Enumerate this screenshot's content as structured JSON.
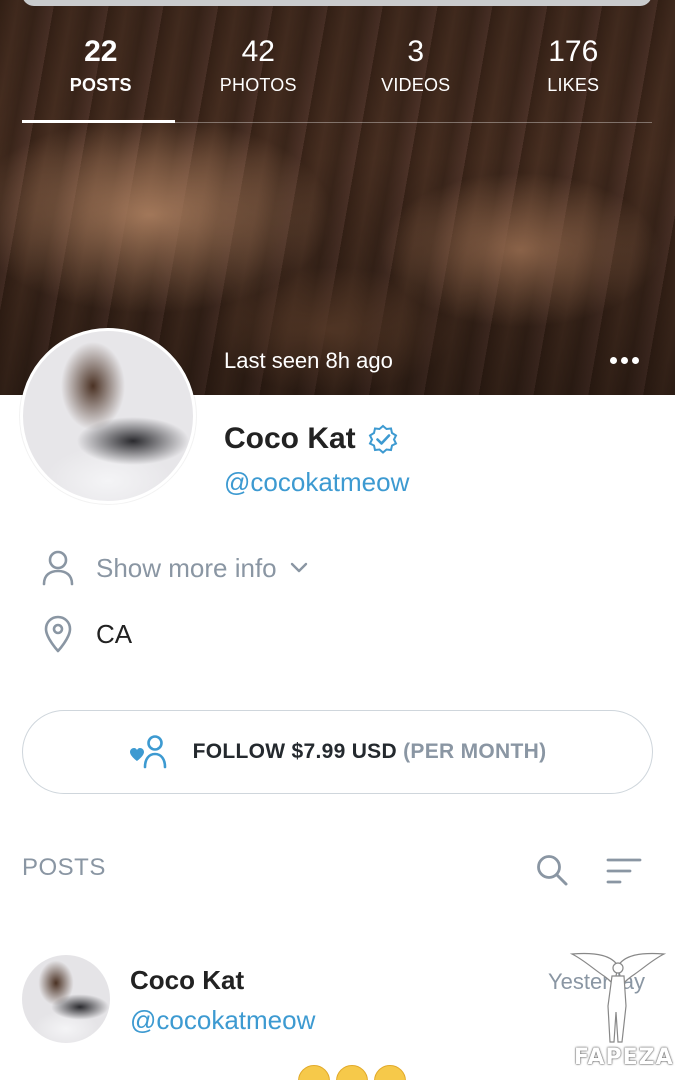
{
  "stats": [
    {
      "value": "22",
      "label": "POSTS",
      "active": true
    },
    {
      "value": "42",
      "label": "PHOTOS",
      "active": false
    },
    {
      "value": "3",
      "label": "VIDEOS",
      "active": false
    },
    {
      "value": "176",
      "label": "LIKES",
      "active": false
    }
  ],
  "cover": {
    "last_seen": "Last seen 8h ago",
    "more_icon": "more-horizontal-icon"
  },
  "profile": {
    "name": "Coco Kat",
    "handle": "@cocokatmeow",
    "verified_icon": "verified-check-icon",
    "show_more_label": "Show more info",
    "location": "CA"
  },
  "follow": {
    "label": "FOLLOW $7.99 USD",
    "period": "(PER MONTH)",
    "icon": "follow-user-heart-icon"
  },
  "posts_section": {
    "title": "POSTS",
    "search_icon": "search-icon",
    "sort_icon": "sort-icon"
  },
  "post": {
    "name": "Coco Kat",
    "handle": "@cocokatmeow",
    "time": "Yesterday"
  },
  "watermark": {
    "text": "FAPEZA"
  },
  "colors": {
    "accent": "#3d9ad1",
    "muted": "#8a96a3",
    "text": "#222222",
    "border": "#cfd6dc"
  }
}
